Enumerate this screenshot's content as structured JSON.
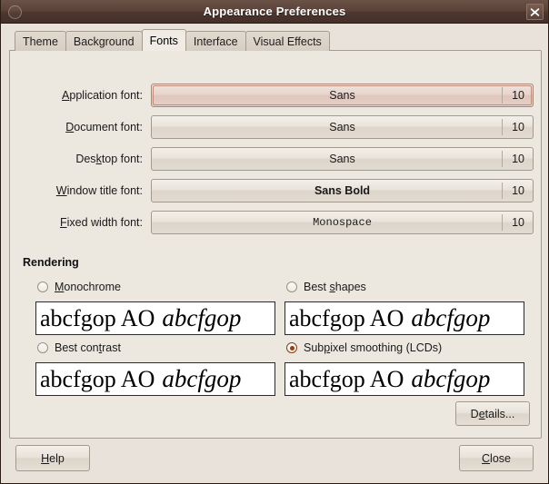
{
  "window": {
    "title": "Appearance Preferences",
    "window_icon": "window-menu-icon",
    "close_icon": "close-icon",
    "titlebar_color": "#523b31",
    "background_color": "#e8e2da"
  },
  "tabs": [
    {
      "label": "Theme",
      "active": false
    },
    {
      "label": "Background",
      "active": false
    },
    {
      "label": "Fonts",
      "active": true
    },
    {
      "label": "Interface",
      "active": false
    },
    {
      "label": "Visual Effects",
      "active": false
    }
  ],
  "fonts": {
    "rows": [
      {
        "label": "Application font:",
        "mnemonic": "A",
        "font": "Sans",
        "size": "10",
        "style": "regular",
        "focused": true
      },
      {
        "label": "Document font:",
        "mnemonic": "D",
        "font": "Sans",
        "size": "10",
        "style": "regular",
        "focused": false
      },
      {
        "label": "Desktop font:",
        "mnemonic": "k",
        "font": "Sans",
        "size": "10",
        "style": "regular",
        "focused": false
      },
      {
        "label": "Window title font:",
        "mnemonic": "W",
        "font": "Sans Bold",
        "size": "10",
        "style": "bold",
        "focused": false
      },
      {
        "label": "Fixed width font:",
        "mnemonic": "F",
        "font": "Monospace",
        "size": "10",
        "style": "mono",
        "focused": false
      }
    ]
  },
  "rendering": {
    "title": "Rendering",
    "selected_color": "#9c3c0c",
    "options": [
      {
        "label": "Monochrome",
        "mnemonic": "M",
        "selected": false
      },
      {
        "label": "Best shapes",
        "mnemonic": "s",
        "selected": false
      },
      {
        "label": "Best contrast",
        "mnemonic": "t",
        "selected": false
      },
      {
        "label": "Subpixel smoothing (LCDs)",
        "mnemonic": "p",
        "selected": true
      }
    ],
    "preview": {
      "regular_text": "abcfgop AO",
      "italic_text": "abcfgop"
    }
  },
  "buttons": {
    "details": {
      "label": "Details...",
      "mnemonic": "e"
    },
    "help": {
      "label": "Help",
      "mnemonic": "H"
    },
    "close": {
      "label": "Close",
      "mnemonic": "C"
    }
  }
}
